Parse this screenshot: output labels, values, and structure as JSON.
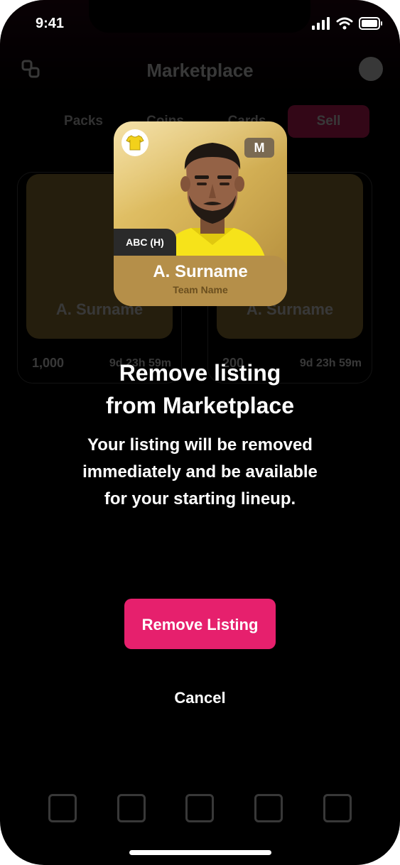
{
  "status": {
    "time": "9:41"
  },
  "background": {
    "title": "Marketplace",
    "tabs": [
      "Packs",
      "Coins",
      "Cards",
      "Sell"
    ],
    "cards": [
      {
        "position": "ABC (H)",
        "name": "A. Surname",
        "price": "1,000",
        "time": "9d 23h 59m"
      },
      {
        "position": "ABC (H)",
        "name": "A. Surname",
        "price": "200",
        "time": "9d 23h 59m"
      }
    ]
  },
  "card": {
    "rarity": "M",
    "position": "ABC (H)",
    "player_name": "A. Surname",
    "team_name": "Team Name"
  },
  "dialog": {
    "title_line1": "Remove listing",
    "title_line2": "from Marketplace",
    "body_line1": "Your listing will be removed",
    "body_line2": "immediately and be available",
    "body_line3": "for your starting lineup.",
    "confirm_label": "Remove Listing",
    "cancel_label": "Cancel"
  },
  "colors": {
    "accent": "#e6206d",
    "card_gold": "#d7b458",
    "background": "#000000"
  }
}
